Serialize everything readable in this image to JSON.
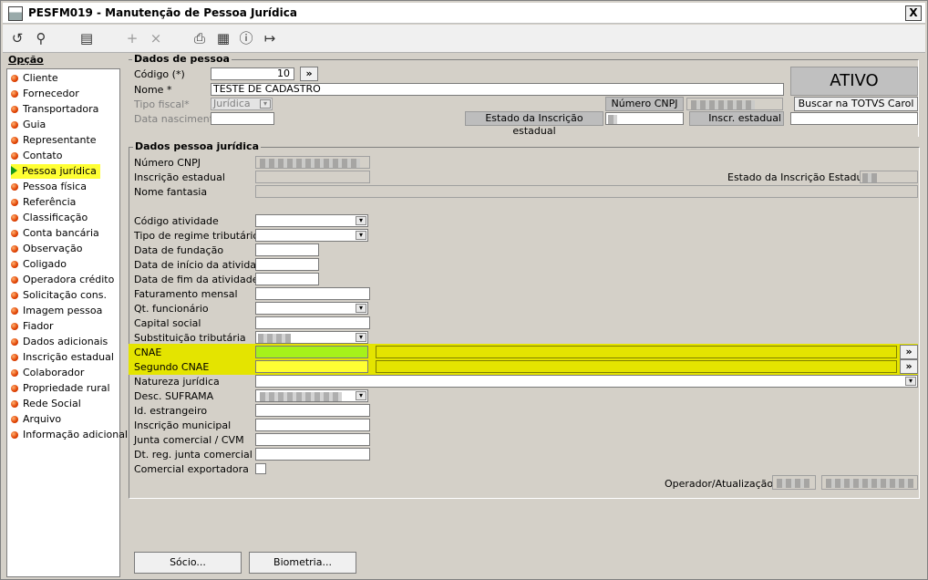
{
  "window": {
    "title": "PESFM019 - Manutenção de Pessoa Jurídica",
    "close_label": "X"
  },
  "toolbar": [
    "undo-icon",
    "search-icon",
    "save-icon",
    "add-icon",
    "delete-icon",
    "print-icon",
    "calendar-icon",
    "help-icon",
    "exit-icon"
  ],
  "sidebar": {
    "title": "Opção",
    "items": [
      "Cliente",
      "Fornecedor",
      "Transportadora",
      "Guia",
      "Representante",
      "Contato",
      "Pessoa jurídica",
      "Pessoa física",
      "Referência",
      "Classificação",
      "Conta bancária",
      "Observação",
      "Coligado",
      "Operadora crédito",
      "Solicitação cons.",
      "Imagem pessoa",
      "Fiador",
      "Dados adicionais",
      "Inscrição estadual",
      "Colaborador",
      "Propriedade rural",
      "Rede Social",
      "Arquivo",
      "Informação adicional"
    ],
    "active_index": 6
  },
  "dados_pessoa": {
    "title": "Dados de pessoa",
    "codigo_label": "Código (*)",
    "codigo_value": "10",
    "codigo_btn": "»",
    "nome_label": "Nome *",
    "nome_value": "TESTE DE CADASTRO",
    "tipo_fiscal_label": "Tipo fiscal*",
    "tipo_fiscal_value": "Jurídica",
    "data_nasc_label": "Data nascimento",
    "numero_cnpj_label": "Número CNPJ",
    "estado_ie_label": "Estado da Inscrição estadual",
    "inscr_estadual_label": "Inscr. estadual",
    "status": "ATIVO",
    "buscar_button": "Buscar na TOTVS Carol"
  },
  "dados_pj": {
    "title": "Dados pessoa jurídica",
    "numero_cnpj": "Número CNPJ",
    "inscricao_estadual": "Inscrição estadual",
    "estado_ie": "Estado da Inscrição Estadual",
    "nome_fantasia": "Nome fantasia",
    "codigo_atividade": "Código atividade",
    "tipo_regime": "Tipo de regime tributário",
    "data_fundacao": "Data de fundação",
    "data_inicio": "Data de início da atividade",
    "data_fim": "Data de fim da atividade",
    "faturamento": "Faturamento mensal",
    "qt_funcionario": "Qt. funcionário",
    "capital_social": "Capital social",
    "substituicao": "Substituição tributária",
    "cnae": "CNAE",
    "segundo_cnae": "Segundo CNAE",
    "natureza": "Natureza jurídica",
    "suframa": "Desc. SUFRAMA",
    "id_estrangeiro": "Id. estrangeiro",
    "inscricao_municipal": "Inscrição municipal",
    "junta": "Junta comercial / CVM",
    "dt_junta": "Dt. reg. junta comercial",
    "comercial_exportadora": "Comercial exportadora",
    "operador": "Operador/Atualização",
    "lookup_btn": "»"
  },
  "footer": {
    "socio_button": "Sócio...",
    "biometria_button": "Biometria..."
  },
  "colors": {
    "highlight": "#e4e400",
    "cnae_input": "#a6f21a",
    "active_item": "#ffff33"
  }
}
